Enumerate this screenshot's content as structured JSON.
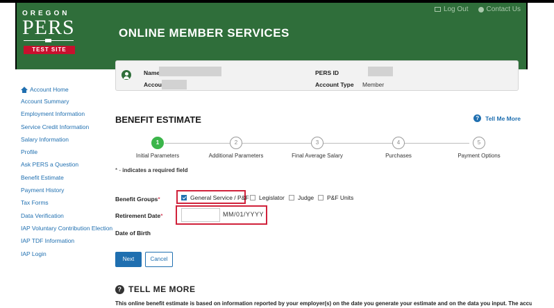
{
  "header": {
    "logo_top": "OREGON",
    "logo_main": "PERS",
    "logo_badge": "TEST SITE",
    "app_title": "ONLINE MEMBER SERVICES",
    "log_out": "Log Out",
    "contact_us": "Contact Us"
  },
  "sidebar": {
    "items": [
      "Account Home",
      "Account Summary",
      "Employment Information",
      "Service Credit Information",
      "Salary Information",
      "Profile",
      "Ask PERS a Question",
      "Benefit Estimate",
      "Payment History",
      "Tax Forms",
      "Data Verification",
      "IAP Voluntary Contribution Election",
      "IAP TDF Information",
      "IAP Login"
    ]
  },
  "member": {
    "name_label": "Name",
    "account_label": "Account",
    "pers_id_label": "PERS ID",
    "account_type_label": "Account Type",
    "account_type_value": "Member"
  },
  "page": {
    "title": "BENEFIT ESTIMATE",
    "tell_me_more": "Tell Me More",
    "required_marker": "* -",
    "required_text": "indicates a required field"
  },
  "steps": [
    {
      "number": "1",
      "label": "Initial Parameters",
      "active": true
    },
    {
      "number": "2",
      "label": "Additional Parameters",
      "active": false
    },
    {
      "number": "3",
      "label": "Final Average Salary",
      "active": false
    },
    {
      "number": "4",
      "label": "Purchases",
      "active": false
    },
    {
      "number": "5",
      "label": "Payment Options",
      "active": false
    }
  ],
  "form": {
    "benefit_groups_label": "Benefit Groups",
    "required_star": "*",
    "options": [
      {
        "label": "General Service / P&F",
        "checked": true
      },
      {
        "label": "Legislator",
        "checked": false
      },
      {
        "label": "Judge",
        "checked": false
      },
      {
        "label": "P&F Units",
        "checked": false
      }
    ],
    "retirement_date_label": "Retirement Date",
    "retirement_date_value": "",
    "date_format_hint": "MM/01/YYYY",
    "dob_label": "Date of Birth"
  },
  "buttons": {
    "next": "Next",
    "cancel": "Cancel"
  },
  "tell_more_section": {
    "heading": "TELL ME MORE",
    "body": "This online benefit estimate is based on information reported by your employer(s) on the date you generate your estimate and on the data you input. The accuracy"
  },
  "colors": {
    "header_green": "#2f6e3a",
    "link_blue": "#1f6fb0",
    "step_active": "#3bb54a",
    "highlight_red": "#d0213a"
  }
}
